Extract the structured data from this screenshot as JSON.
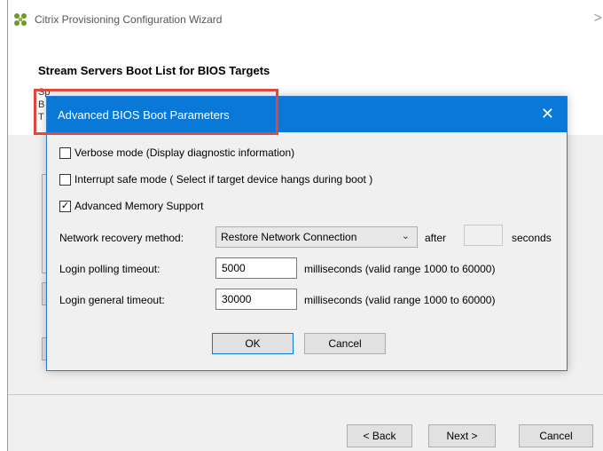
{
  "wizard": {
    "title": "Citrix Provisioning Configuration Wizard",
    "close_glyph": ">",
    "heading": "Stream Servers Boot List for BIOS Targets",
    "bg_line1": "Sp",
    "bg_line2": "B",
    "bg_line3": "T",
    "buttons": {
      "back": "< Back",
      "next": "Next >",
      "cancel": "Cancel"
    }
  },
  "dialog": {
    "title": "Advanced BIOS Boot Parameters",
    "close_glyph": "✕",
    "checkboxes": [
      {
        "label": "Verbose mode (Display diagnostic information)",
        "checked": false
      },
      {
        "label": "Interrupt safe mode ( Select if target device hangs during boot )",
        "checked": false
      },
      {
        "label": "Advanced Memory Support",
        "checked": true
      }
    ],
    "network_recovery": {
      "label": "Network recovery method:",
      "selected": "Restore Network Connection",
      "after_label": "after",
      "after_value": "",
      "seconds_label": "seconds"
    },
    "login_polling": {
      "label": "Login polling timeout:",
      "value": "5000",
      "hint": "milliseconds (valid range 1000 to 60000)"
    },
    "login_general": {
      "label": "Login general timeout:",
      "value": "30000",
      "hint": "milliseconds (valid range 1000 to 60000)"
    },
    "buttons": {
      "ok": "OK",
      "cancel": "Cancel"
    }
  },
  "colors": {
    "accent": "#0a78d7",
    "highlight": "#e0483d"
  }
}
